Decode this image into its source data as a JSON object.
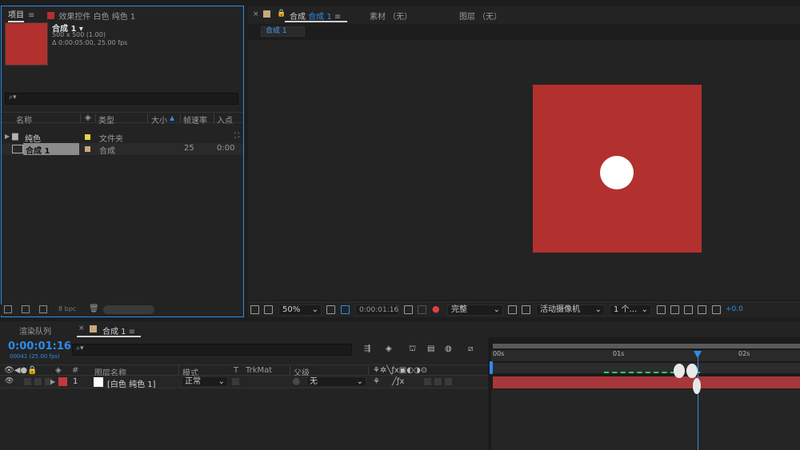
{
  "project_panel": {
    "tab_project": "项目",
    "tab_effects": "效果控件 白色 纯色 1",
    "comp_name": "合成 1 ▾",
    "comp_size": "500 x 500 (1.00)",
    "comp_duration": "Δ 0:00:05:00, 25.00 fps",
    "search_placeholder": "",
    "columns": {
      "name": "名称",
      "type": "类型",
      "size": "大小",
      "fps": "帧速率",
      "in": "入点"
    },
    "rows": [
      {
        "name": "纯色",
        "type": "文件夹",
        "fps": "",
        "in": "",
        "label_color": "#e8d44d"
      },
      {
        "name": "合成 1",
        "type": "合成",
        "fps": "25",
        "in": "0:00",
        "label_color": "#c8a97a"
      }
    ],
    "footer_bpc": "8 bpc"
  },
  "viewer": {
    "tab_comp_prefix": "合成",
    "tab_comp_name": "合成 1",
    "tab_footage": "素材 （无）",
    "tab_layer": "图层 （无）",
    "subtab": "合成 1",
    "toolbar": {
      "zoom": "50%",
      "timecode": "0:00:01:16",
      "resolution": "完整",
      "camera": "活动摄像机",
      "views": "1 个...",
      "exposure": "+0.0"
    }
  },
  "timeline": {
    "tab_render": "渲染队列",
    "tab_comp": "合成 1",
    "timecode": "0:00:01:16",
    "frames": "00041 (25.00 fps)",
    "columns": {
      "num": "#",
      "layer_name": "图层名称",
      "mode": "模式",
      "t": "T",
      "trkmat": "TrkMat",
      "parent": "父级"
    },
    "layer": {
      "num": "1",
      "name": "[白色 纯色 1]",
      "mode": "正常",
      "parent": "无"
    },
    "ruler": {
      "t0": "00s",
      "t1": "01s",
      "t2": "02s"
    }
  }
}
